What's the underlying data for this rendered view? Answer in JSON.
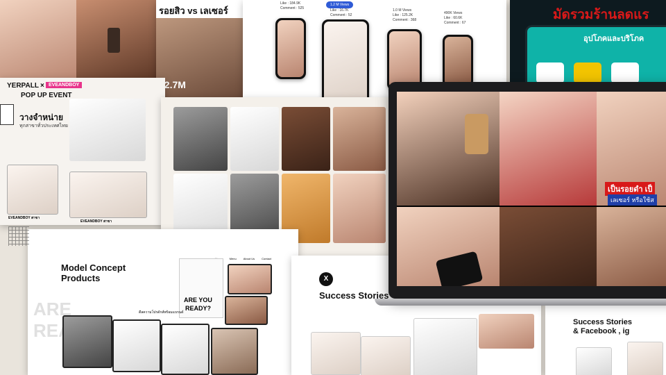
{
  "tiktok": {
    "top_title": "รอยสิว vs เลเซอร์",
    "views": "12.7M"
  },
  "phone_stats": {
    "bubble": "1.2 M Views",
    "like": "Like : 16.7K",
    "comment": "Comment : 52",
    "p1_like": "Like : 184.9K",
    "p1_comment": "Comment : 525",
    "p3_views": "1.0 M Views",
    "p3_like": "Like : 125.2K",
    "p3_comment": "Comment : 368",
    "p4_views": "490K Views",
    "p4_like": "Like : 60.6K",
    "p4_comment": "Comment : 67"
  },
  "promo_banner": {
    "title": "มัดรวมร้านลดแร",
    "subtitle": "อุปโภคและบริโภค"
  },
  "popup": {
    "brand": "YERPALL",
    "x": "×",
    "partner": "EVEANDBOY",
    "event": "POP UP EVENT",
    "thai1": "วางจำหน่าย",
    "thai2": "ทุกสาขาทั่วประเทศไทย",
    "store1": "EVEANDBOY สาขา",
    "store2": "EVEANDBOY สาขา"
  },
  "model_concept": {
    "title_line1": "Model Concept",
    "title_line2": "Products",
    "nav": [
      "Home",
      "Menu",
      "About Us",
      "Contact"
    ],
    "poster_line1": "ARE YOU",
    "poster_line2": "READY?",
    "caption": "ดีลความโปรดักส์พร้อมแบรนด์",
    "watermark": "ARE READ"
  },
  "success1": {
    "title": "Success Stories",
    "x_logo": "X"
  },
  "success2": {
    "title_line1": "Success Stories",
    "title_line2": "& Facebook , ig"
  },
  "laptop": {
    "caption_red": "เป็นรอยดำ เป็",
    "caption_blue": "เลเซอร์ หรือใช้ส"
  },
  "colors": {
    "bubble_blue": "#2f5bd6",
    "thai_red": "#d81919",
    "promo_teal": "#0fb3a8"
  }
}
